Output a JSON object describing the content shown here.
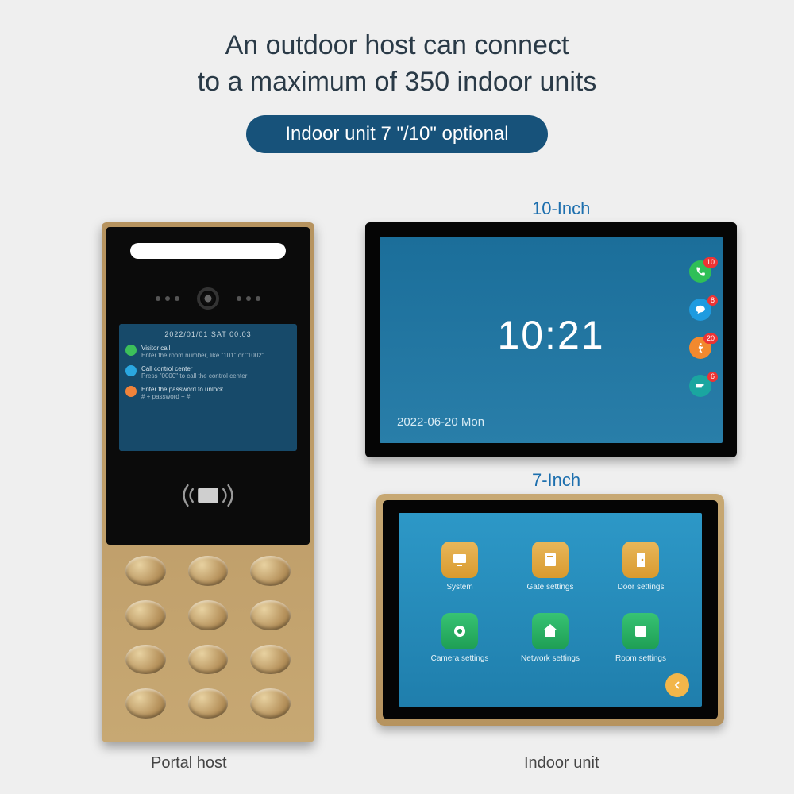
{
  "headline_l1": "An outdoor host can connect",
  "headline_l2": "to a maximum of 350 indoor units",
  "pill": "Indoor unit 7 \"/10\" optional",
  "portal": {
    "caption": "Portal host",
    "screen_date": "2022/01/01 SAT 00:03",
    "rows": [
      {
        "title": "Visitor call",
        "sub": "Enter the room number, like \"101\" or \"1002\""
      },
      {
        "title": "Call control center",
        "sub": "Press \"0000\" to call the control center"
      },
      {
        "title": "Enter the password to unlock",
        "sub": "# + password + #"
      }
    ]
  },
  "indoor_caption": "Indoor unit",
  "mon10": {
    "label": "10-Inch",
    "time": "10:21",
    "date": "2022-06-20  Mon",
    "badges": [
      "10",
      "8",
      "20",
      "6"
    ]
  },
  "mon7": {
    "label": "7-Inch",
    "apps": [
      "System",
      "Gate settings",
      "Door settings",
      "Camera settings",
      "Network settings",
      "Room settings"
    ]
  }
}
